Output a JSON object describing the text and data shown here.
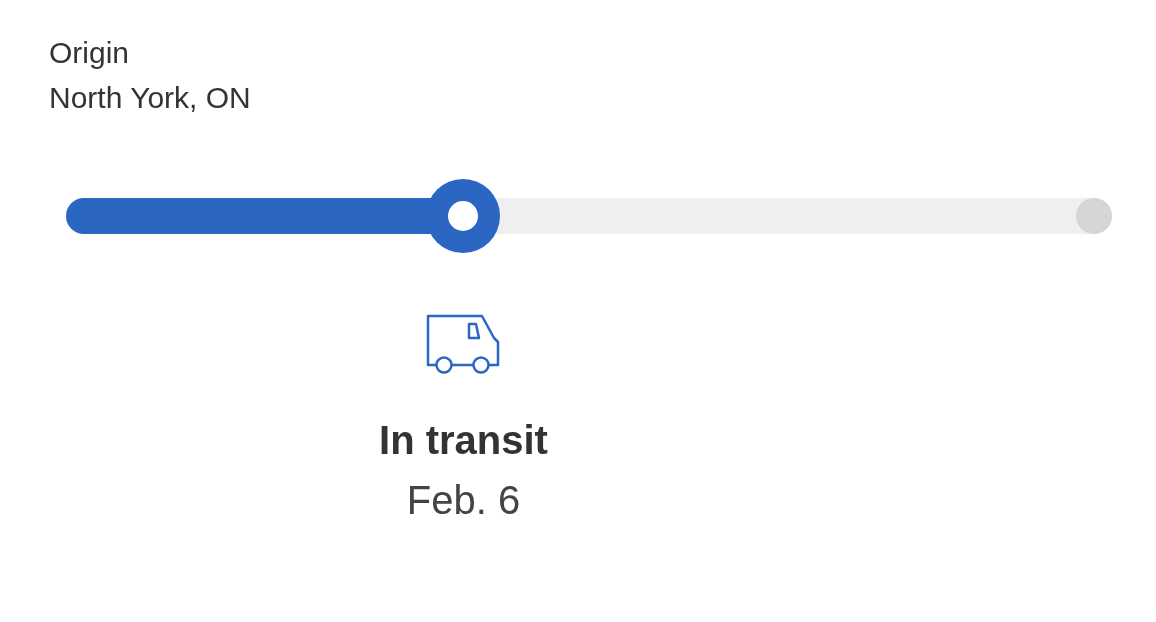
{
  "origin": {
    "label": "Origin",
    "location": "North York, ON"
  },
  "progress": {
    "level": 0.38
  },
  "status": {
    "title": "In transit",
    "date": "Feb. 6"
  }
}
